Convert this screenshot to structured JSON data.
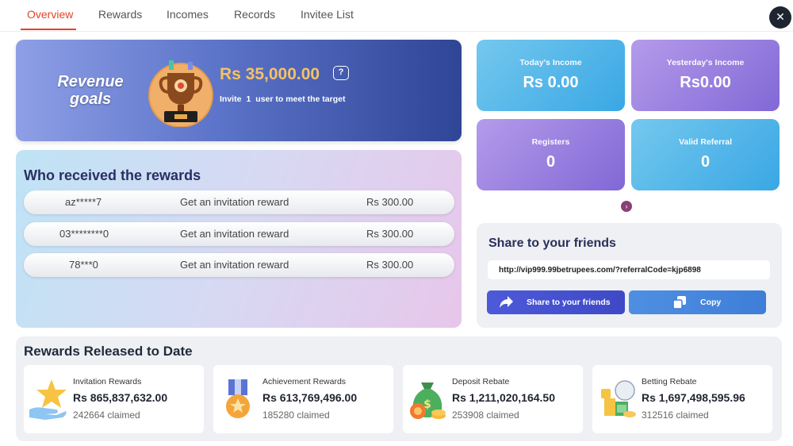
{
  "tabs": [
    {
      "label": "Overview",
      "active": true
    },
    {
      "label": "Rewards",
      "active": false
    },
    {
      "label": "Incomes",
      "active": false
    },
    {
      "label": "Records",
      "active": false
    },
    {
      "label": "Invitee List",
      "active": false
    }
  ],
  "close_icon": "close-icon",
  "revenue": {
    "title": "Revenue goals",
    "amount": "Rs 35,000.00",
    "help_symbol": "?",
    "invite_prefix": "Invite",
    "invite_count": "1",
    "invite_suffix": "user to meet the target"
  },
  "who_received": {
    "title": "Who received the rewards",
    "rows": [
      {
        "user": "az*****7",
        "description": "Get an invitation reward",
        "amount": "Rs 300.00"
      },
      {
        "user": "03********0",
        "description": "Get an invitation reward",
        "amount": "Rs 300.00"
      },
      {
        "user": "78***0",
        "description": "Get an invitation reward",
        "amount": "Rs 300.00"
      }
    ]
  },
  "stats": [
    {
      "label": "Today's Income",
      "value": "Rs 0.00",
      "color": "#3aa7e4"
    },
    {
      "label": "Yesterday's Income",
      "value": "Rs0.00",
      "color": "#8168d6"
    },
    {
      "label": "Registers",
      "value": "0",
      "color": "#8168d6"
    },
    {
      "label": "Valid Referral",
      "value": "0",
      "color": "#3aa7e4"
    }
  ],
  "share": {
    "title": "Share to your friends",
    "link": "http://vip999.99betrupees.com/?referralCode=kjp6898",
    "share_button": "Share to your friends",
    "copy_button": "Copy"
  },
  "released": {
    "title": "Rewards Released to Date",
    "cards": [
      {
        "name": "Invitation Rewards",
        "amount": "Rs 865,837,632.00",
        "claimed": "242664 claimed",
        "icon": "star-hand-icon"
      },
      {
        "name": "Achievement Rewards",
        "amount": "Rs 613,769,496.00",
        "claimed": "185280 claimed",
        "icon": "medal-icon"
      },
      {
        "name": "Deposit Rebate",
        "amount": "Rs 1,211,020,164.50",
        "claimed": "253908 claimed",
        "icon": "money-bag-icon"
      },
      {
        "name": "Betting Rebate",
        "amount": "Rs 1,697,498,595.96",
        "claimed": "312516 claimed",
        "icon": "casino-chips-icon"
      }
    ]
  },
  "colors": {
    "accent": "#e0442b",
    "revenue_amount": "#f5c264",
    "title_text": "#2a2f63"
  }
}
